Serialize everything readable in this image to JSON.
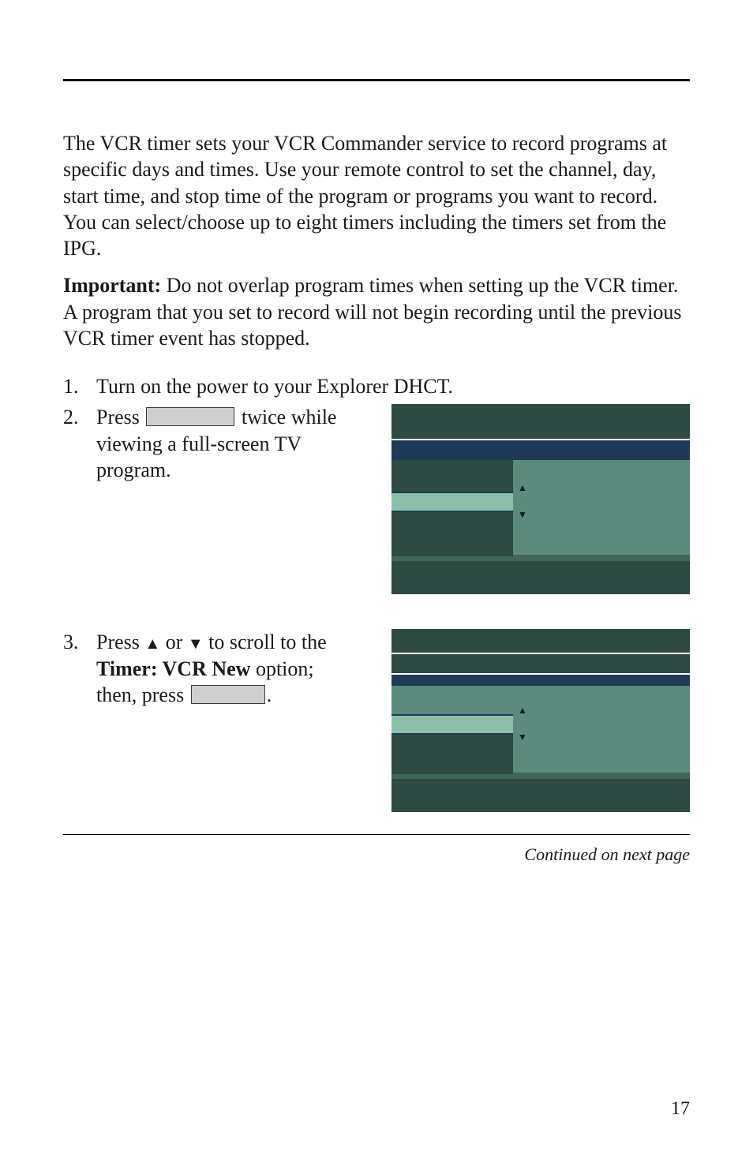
{
  "intro": "The VCR timer sets your VCR Commander service to record programs at specific days and times. Use your remote control to set the channel, day, start time, and stop time of the program or programs you want to record. You can select/choose up to eight timers including the timers set from the IPG.",
  "important_label": "Important:",
  "important_text": " Do not overlap program times when setting up the VCR timer. A program that you set to record will not begin recording until the previous VCR timer event has stopped.",
  "steps": {
    "s1": {
      "num": "1.",
      "text": "Turn on the power to your Explorer DHCT."
    },
    "s2": {
      "num": "2.",
      "pre": "Press ",
      "post": " twice while viewing a full-screen TV program."
    },
    "s3": {
      "num": "3.",
      "pre": "Press ",
      "up": "▲",
      "mid": " or ",
      "down": "▼",
      "post1": " to scroll to the ",
      "bold": "Timer: VCR New",
      "post2": " option; then, press ",
      "end": "."
    }
  },
  "continued": "Continued on next page",
  "page_number": "17"
}
